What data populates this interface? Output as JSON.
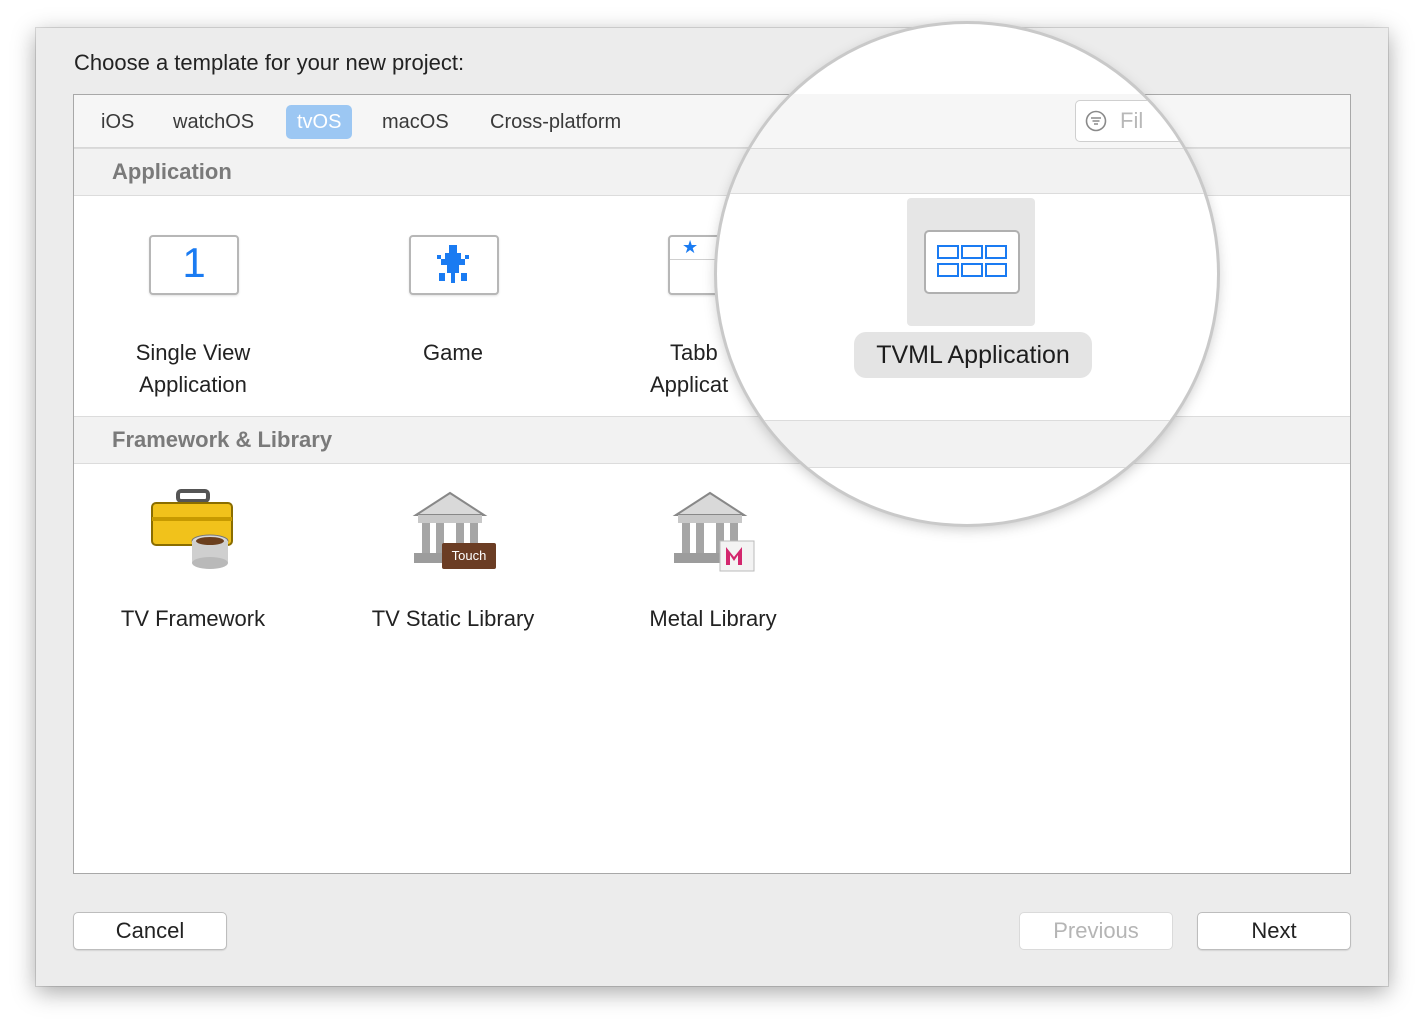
{
  "dialog": {
    "prompt": "Choose a template for your new project:"
  },
  "tabs": [
    {
      "label": "iOS",
      "selected": false
    },
    {
      "label": "watchOS",
      "selected": false
    },
    {
      "label": "tvOS",
      "selected": true
    },
    {
      "label": "macOS",
      "selected": false
    },
    {
      "label": "Cross-platform",
      "selected": false
    }
  ],
  "filter": {
    "visible_text": "Fil",
    "icon": "filter-icon"
  },
  "sections": [
    {
      "title": "Application",
      "items": [
        {
          "label_line1": "Single View",
          "label_line2": "Application",
          "icon": "single-view-app-icon"
        },
        {
          "label_line1": "Game",
          "label_line2": "",
          "icon": "game-icon"
        },
        {
          "label_line1": "Tabb",
          "label_line2": "Applicat",
          "icon": "tabbed-app-icon"
        },
        {
          "label_line1": "TVML Application",
          "label_line2": "",
          "icon": "tvml-app-icon",
          "selected": true
        }
      ]
    },
    {
      "title": "Framework & Library",
      "items": [
        {
          "label": "TV Framework",
          "icon": "toolbox-icon"
        },
        {
          "label": "TV Static Library",
          "icon": "static-library-icon",
          "badge": "Touch"
        },
        {
          "label": "Metal Library",
          "icon": "metal-library-icon"
        }
      ]
    }
  ],
  "buttons": {
    "cancel": "Cancel",
    "previous": "Previous",
    "next": "Next"
  },
  "colors": {
    "accent": "#1a7bf2",
    "tab_selected_bg": "#9cc7f3",
    "selection_bg": "#e4e4e4"
  }
}
